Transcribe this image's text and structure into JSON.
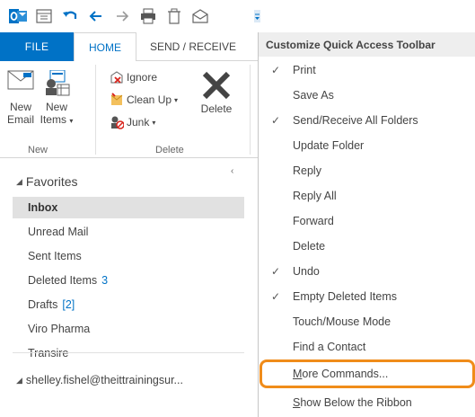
{
  "qat": {
    "icons": [
      "outlook-logo",
      "save",
      "undo",
      "back",
      "forward",
      "print",
      "empty-deleted",
      "send-receive",
      "customize-dropdown"
    ]
  },
  "tabs": {
    "file": "FILE",
    "home": "HOME",
    "send_receive": "SEND / RECEIVE"
  },
  "ribbon": {
    "new_email": [
      "New",
      "Email"
    ],
    "new_items": [
      "New",
      "Items"
    ],
    "ignore": "Ignore",
    "clean_up": "Clean Up",
    "junk": "Junk",
    "delete": "Delete",
    "group_new": "New",
    "group_delete": "Delete"
  },
  "folders": {
    "favorites": "Favorites",
    "items": [
      {
        "label": "Inbox",
        "count": ""
      },
      {
        "label": "Unread Mail",
        "count": ""
      },
      {
        "label": "Sent Items",
        "count": ""
      },
      {
        "label": "Deleted Items",
        "count": "3"
      },
      {
        "label": "Drafts",
        "count": "[2]"
      },
      {
        "label": "Viro Pharma",
        "count": ""
      },
      {
        "label": "Transire",
        "count": ""
      }
    ],
    "account": "shelley.fishel@theittrainingsur..."
  },
  "menu": {
    "title": "Customize Quick Access Toolbar",
    "items": [
      {
        "label": "Print",
        "checked": true
      },
      {
        "label": "Save As",
        "checked": false
      },
      {
        "label": "Send/Receive All Folders",
        "checked": true
      },
      {
        "label": "Update Folder",
        "checked": false
      },
      {
        "label": "Reply",
        "checked": false
      },
      {
        "label": "Reply All",
        "checked": false
      },
      {
        "label": "Forward",
        "checked": false
      },
      {
        "label": "Delete",
        "checked": false
      },
      {
        "label": "Undo",
        "checked": true
      },
      {
        "label": "Empty Deleted Items",
        "checked": true
      },
      {
        "label": "Touch/Mouse Mode",
        "checked": false
      },
      {
        "label": "Find a Contact",
        "checked": false
      },
      {
        "label": "More Commands...",
        "checked": false,
        "underline": "M",
        "rest": "ore Commands..."
      },
      {
        "label": "Show Below the Ribbon",
        "checked": false,
        "underline": "S",
        "rest": "how Below the Ribbon"
      }
    ],
    "check_glyph": "✓"
  },
  "colors": {
    "accent": "#0072c6",
    "highlight_outline": "#f08c1a",
    "selected_bg": "#e1e1e1",
    "menu_header_bg": "#eeeeee"
  }
}
